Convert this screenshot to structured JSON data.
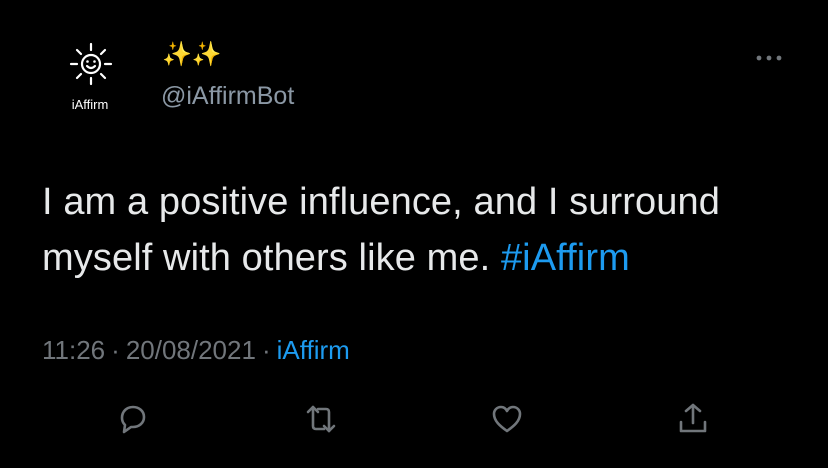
{
  "avatar": {
    "label": "iAffirm",
    "icon": "sun-smiley-icon"
  },
  "author": {
    "display_name": "✨✨",
    "handle": "@iAffirmBot"
  },
  "tweet": {
    "text": "I am a positive influence, and I surround myself with others like me. ",
    "hashtag": "#iAffirm"
  },
  "meta": {
    "time": "11:26",
    "separator1": "·",
    "date": "20/08/2021",
    "separator2": "·",
    "source": "iAffirm"
  },
  "actions": {
    "reply_icon": "reply-icon",
    "retweet_icon": "retweet-icon",
    "like_icon": "like-icon",
    "share_icon": "share-icon"
  },
  "colors": {
    "background": "#000000",
    "text": "#e7e9ea",
    "muted": "#71767b",
    "link": "#1d9bf0",
    "sparkle": "#f5c542"
  }
}
